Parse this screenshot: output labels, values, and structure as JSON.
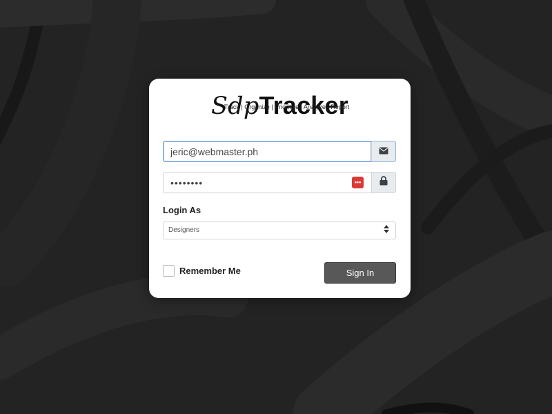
{
  "logo": {
    "script_part": "Sdp",
    "main_part": "Tracker",
    "tagline": "Track | Organize | Prioritize | Analyze | Report"
  },
  "email": {
    "value": "jeric@webmaster.ph",
    "icon": "envelope-icon"
  },
  "password": {
    "masked_value": "••••••••",
    "manager_icon": "password-manager-icon",
    "icon": "lock-icon"
  },
  "login_as": {
    "label": "Login As",
    "selected": "Designers"
  },
  "remember": {
    "label": "Remember Me",
    "checked": false
  },
  "signin": {
    "label": "Sign In"
  },
  "colors": {
    "background": "#232323",
    "button": "#585858",
    "focus_border": "#8fb3e0",
    "password_manager": "#d93a36"
  }
}
